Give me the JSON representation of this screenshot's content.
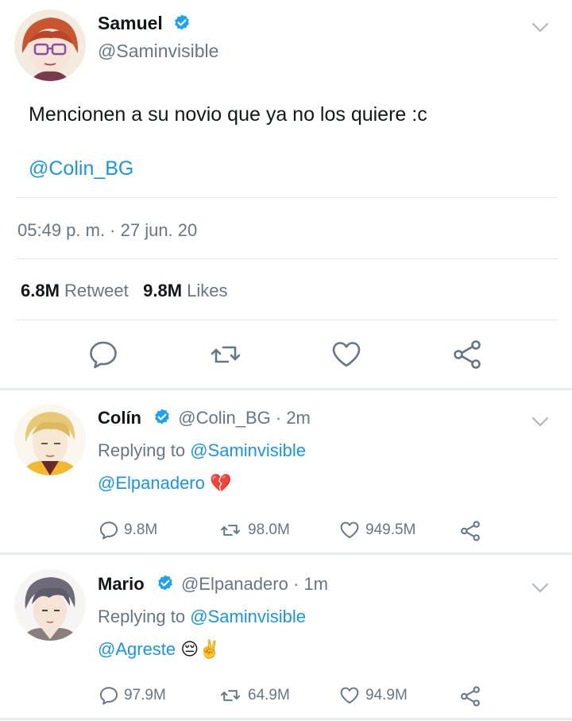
{
  "tweet": {
    "author_name": "Samuel",
    "author_handle": "@Saminvisible",
    "text": "Mencionen a su novio que ya no los quiere :c",
    "mention": "@Colin_BG",
    "timestamp": "05:49 p. m. · 27 jun. 20",
    "retweet_count": "6.8M",
    "retweet_label": "Retweet",
    "like_count": "9.8M",
    "like_label": "Likes"
  },
  "replies": [
    {
      "name": "Colín",
      "handle": "@Colin_BG",
      "time": "· 2m",
      "replying_label": "Replying to",
      "replying_to": "@Saminvisible",
      "mention": "@Elpanadero",
      "emoji": "💔",
      "replies": "9.8M",
      "retweets": "98.0M",
      "likes": "949.5M"
    },
    {
      "name": "Mario",
      "handle": "@Elpanadero",
      "time": "· 1m",
      "replying_label": "Replying to",
      "replying_to": "@Saminvisible",
      "mention": "@Agreste",
      "emoji": "😔✌️",
      "replies": "97.9M",
      "retweets": "64.9M",
      "likes": "94.9M"
    }
  ],
  "icons": {
    "verified": "verified-badge-icon",
    "chevron": "chevron-down-icon",
    "reply": "reply-icon",
    "retweet": "retweet-icon",
    "like": "heart-icon",
    "share": "share-icon"
  },
  "colors": {
    "link": "#1b95e0",
    "muted": "#657786",
    "verified": "#1da1f2",
    "divider": "#e1e8ed"
  }
}
